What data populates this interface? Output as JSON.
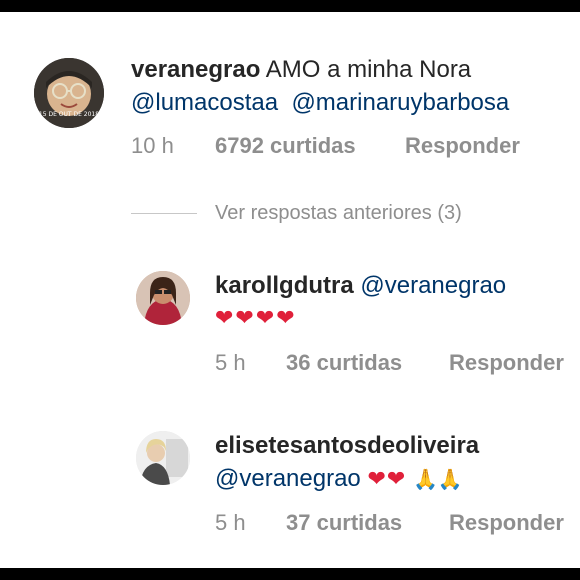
{
  "comment": {
    "username": "veranegrao",
    "text": "AMO a minha Nora",
    "mentions": [
      "@lumacostaa",
      "@marinaruybarbosa"
    ],
    "time": "10 h",
    "likes": "6792 curtidas",
    "reply_label": "Responder",
    "avatar_caption": "15 DE OUT DE 2018"
  },
  "view_previous": {
    "label": "Ver respostas anteriores (3)"
  },
  "replies": [
    {
      "username": "karollgdutra",
      "mention": "@veranegrao",
      "hearts": "❤❤❤❤",
      "time": "5 h",
      "likes": "36 curtidas",
      "reply_label": "Responder"
    },
    {
      "username": "elisetesantosdeoliveira",
      "mention": "@veranegrao",
      "hearts": "❤❤",
      "extra_emoji": "🙏🙏",
      "time": "5 h",
      "likes": "37 curtidas",
      "reply_label": "Responder"
    }
  ]
}
